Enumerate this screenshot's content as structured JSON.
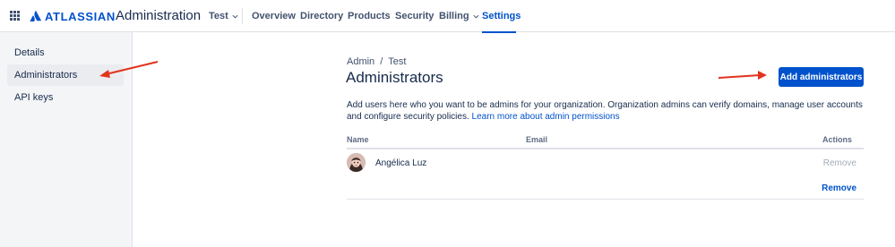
{
  "brand": {
    "logo_text": "ATLASSIAN",
    "product_name": "Administration",
    "accent_color": "#0052cc",
    "annotation_color": "#e0341e"
  },
  "topnav": {
    "org_switcher": "Test",
    "items": [
      {
        "label": "Overview"
      },
      {
        "label": "Directory"
      },
      {
        "label": "Products"
      },
      {
        "label": "Security"
      },
      {
        "label": "Billing"
      },
      {
        "label": "Settings"
      }
    ]
  },
  "sidebar": {
    "items": [
      {
        "label": "Details"
      },
      {
        "label": "Administrators"
      },
      {
        "label": "API keys"
      }
    ]
  },
  "main": {
    "breadcrumb": [
      "Admin",
      "Test"
    ],
    "title": "Administrators",
    "add_button_label": "Add administrators",
    "description_text": "Add users here who you want to be admins for your organization. Organization admins can verify domains, manage user accounts and configure security policies.",
    "description_link": "Learn more about admin permissions",
    "table": {
      "columns": [
        "Name",
        "Email",
        "Actions"
      ],
      "rows": [
        {
          "name": "Angélica Luz",
          "email": "",
          "action": "Remove",
          "action_enabled": false
        }
      ],
      "footer_action": "Remove"
    }
  }
}
